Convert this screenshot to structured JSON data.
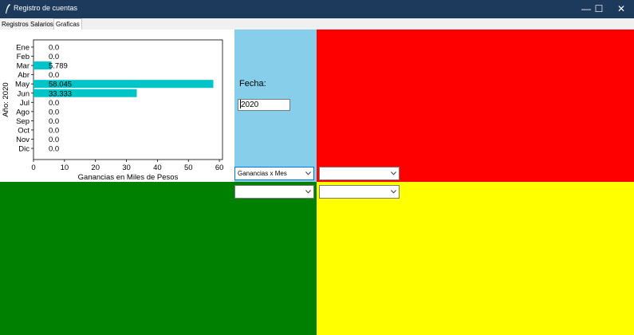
{
  "window": {
    "title": "Registro de cuentas",
    "controls": {
      "minimize": "—",
      "maximize": "☐",
      "close": "✕"
    }
  },
  "tabs": [
    {
      "label": "Registros",
      "active": false
    },
    {
      "label": "Salarios",
      "active": false
    },
    {
      "label": "Graficas",
      "active": true
    }
  ],
  "form": {
    "fecha_label": "Fecha:",
    "fecha_value": "2020",
    "combo_chart_type": "Ganancias x Mes",
    "combo_right_top": "",
    "combo_left_bottom": "",
    "combo_right_bottom": ""
  },
  "colors": {
    "bar": "#00c5c8",
    "panel_blue": "#87ceeb",
    "panel_red": "#ff0000",
    "panel_green": "#008000",
    "panel_yellow": "#ffff00"
  },
  "chart_data": {
    "type": "bar",
    "orientation": "horizontal",
    "categories": [
      "Ene",
      "Feb",
      "Mar",
      "Abr",
      "May",
      "Jun",
      "Jul",
      "Ago",
      "Sep",
      "Oct",
      "Nov",
      "Dic"
    ],
    "values": [
      0.0,
      0.0,
      5.789,
      0.0,
      58.045,
      33.333,
      0.0,
      0.0,
      0.0,
      0.0,
      0.0,
      0.0
    ],
    "data_labels": [
      "0.0",
      "0.0",
      "5.789",
      "0.0",
      "58.045",
      "33.333",
      "0.0",
      "0.0",
      "0.0",
      "0.0",
      "0.0",
      "0.0"
    ],
    "xlabel": "Ganancias en Miles de Pesos",
    "ylabel": "Año: 2020",
    "xlim": [
      0,
      61
    ],
    "xticks": [
      0,
      10,
      20,
      30,
      40,
      50,
      60
    ],
    "grid": false
  }
}
